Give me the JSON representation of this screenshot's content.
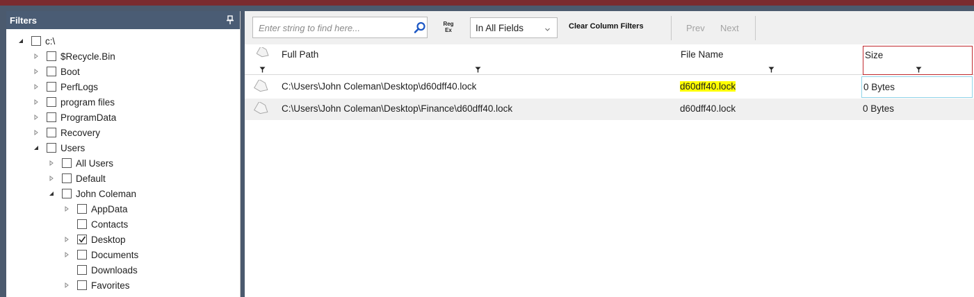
{
  "filters": {
    "title": "Filters",
    "tree": [
      {
        "label": "c:\\",
        "expander": "expanded",
        "checked": false
      },
      {
        "label": "$Recycle.Bin",
        "expander": "collapsed",
        "checked": false
      },
      {
        "label": "Boot",
        "expander": "collapsed",
        "checked": false
      },
      {
        "label": "PerfLogs",
        "expander": "collapsed",
        "checked": false
      },
      {
        "label": "program files",
        "expander": "collapsed",
        "checked": false
      },
      {
        "label": "ProgramData",
        "expander": "collapsed",
        "checked": false
      },
      {
        "label": "Recovery",
        "expander": "collapsed",
        "checked": false
      },
      {
        "label": "Users",
        "expander": "expanded",
        "checked": false
      },
      {
        "label": "All Users",
        "expander": "collapsed",
        "checked": false
      },
      {
        "label": "Default",
        "expander": "collapsed",
        "checked": false
      },
      {
        "label": "John Coleman",
        "expander": "expanded",
        "checked": false
      },
      {
        "label": "AppData",
        "expander": "collapsed",
        "checked": false
      },
      {
        "label": "Contacts",
        "expander": "none",
        "checked": false
      },
      {
        "label": "Desktop",
        "expander": "collapsed",
        "checked": true
      },
      {
        "label": "Documents",
        "expander": "collapsed",
        "checked": false
      },
      {
        "label": "Downloads",
        "expander": "none",
        "checked": false
      },
      {
        "label": "Favorites",
        "expander": "collapsed",
        "checked": false
      }
    ]
  },
  "toolbar": {
    "search_placeholder": "Enter string to find here...",
    "regex_line1": "Reg",
    "regex_line2": "Ex",
    "fields_select_value": "In All Fields",
    "clear_filters_label": "Clear Column Filters",
    "prev_label": "Prev",
    "next_label": "Next"
  },
  "grid": {
    "columns": {
      "full_path": "Full Path",
      "file_name": "File Name",
      "size": "Size"
    },
    "rows": [
      {
        "full_path": "C:\\Users\\John Coleman\\Desktop\\d60dff40.lock",
        "file_name": "d60dff40.lock",
        "size": "0 Bytes"
      },
      {
        "full_path": "C:\\Users\\John Coleman\\Desktop\\Finance\\d60dff40.lock",
        "file_name": "d60dff40.lock",
        "size": "0 Bytes"
      }
    ]
  },
  "colors": {
    "title_bar": "#7a2b2f",
    "panel_header": "#4a5c74",
    "highlight": "#ffff00",
    "size_header_border": "#c0282d",
    "selected_cell_border": "#8fd3e8",
    "alt_row": "#f0f0f0"
  }
}
